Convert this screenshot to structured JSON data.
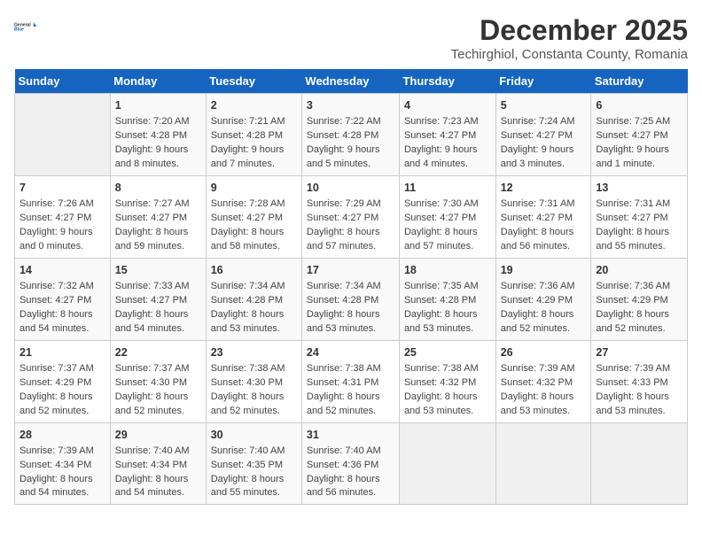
{
  "logo": {
    "general": "General",
    "blue": "Blue"
  },
  "title": "December 2025",
  "subtitle": "Techirghiol, Constanta County, Romania",
  "weekdays": [
    "Sunday",
    "Monday",
    "Tuesday",
    "Wednesday",
    "Thursday",
    "Friday",
    "Saturday"
  ],
  "weeks": [
    [
      {
        "day": "",
        "info": ""
      },
      {
        "day": "1",
        "info": "Sunrise: 7:20 AM\nSunset: 4:28 PM\nDaylight: 9 hours\nand 8 minutes."
      },
      {
        "day": "2",
        "info": "Sunrise: 7:21 AM\nSunset: 4:28 PM\nDaylight: 9 hours\nand 7 minutes."
      },
      {
        "day": "3",
        "info": "Sunrise: 7:22 AM\nSunset: 4:28 PM\nDaylight: 9 hours\nand 5 minutes."
      },
      {
        "day": "4",
        "info": "Sunrise: 7:23 AM\nSunset: 4:27 PM\nDaylight: 9 hours\nand 4 minutes."
      },
      {
        "day": "5",
        "info": "Sunrise: 7:24 AM\nSunset: 4:27 PM\nDaylight: 9 hours\nand 3 minutes."
      },
      {
        "day": "6",
        "info": "Sunrise: 7:25 AM\nSunset: 4:27 PM\nDaylight: 9 hours\nand 1 minute."
      }
    ],
    [
      {
        "day": "7",
        "info": "Sunrise: 7:26 AM\nSunset: 4:27 PM\nDaylight: 9 hours\nand 0 minutes."
      },
      {
        "day": "8",
        "info": "Sunrise: 7:27 AM\nSunset: 4:27 PM\nDaylight: 8 hours\nand 59 minutes."
      },
      {
        "day": "9",
        "info": "Sunrise: 7:28 AM\nSunset: 4:27 PM\nDaylight: 8 hours\nand 58 minutes."
      },
      {
        "day": "10",
        "info": "Sunrise: 7:29 AM\nSunset: 4:27 PM\nDaylight: 8 hours\nand 57 minutes."
      },
      {
        "day": "11",
        "info": "Sunrise: 7:30 AM\nSunset: 4:27 PM\nDaylight: 8 hours\nand 57 minutes."
      },
      {
        "day": "12",
        "info": "Sunrise: 7:31 AM\nSunset: 4:27 PM\nDaylight: 8 hours\nand 56 minutes."
      },
      {
        "day": "13",
        "info": "Sunrise: 7:31 AM\nSunset: 4:27 PM\nDaylight: 8 hours\nand 55 minutes."
      }
    ],
    [
      {
        "day": "14",
        "info": "Sunrise: 7:32 AM\nSunset: 4:27 PM\nDaylight: 8 hours\nand 54 minutes."
      },
      {
        "day": "15",
        "info": "Sunrise: 7:33 AM\nSunset: 4:27 PM\nDaylight: 8 hours\nand 54 minutes."
      },
      {
        "day": "16",
        "info": "Sunrise: 7:34 AM\nSunset: 4:28 PM\nDaylight: 8 hours\nand 53 minutes."
      },
      {
        "day": "17",
        "info": "Sunrise: 7:34 AM\nSunset: 4:28 PM\nDaylight: 8 hours\nand 53 minutes."
      },
      {
        "day": "18",
        "info": "Sunrise: 7:35 AM\nSunset: 4:28 PM\nDaylight: 8 hours\nand 53 minutes."
      },
      {
        "day": "19",
        "info": "Sunrise: 7:36 AM\nSunset: 4:29 PM\nDaylight: 8 hours\nand 52 minutes."
      },
      {
        "day": "20",
        "info": "Sunrise: 7:36 AM\nSunset: 4:29 PM\nDaylight: 8 hours\nand 52 minutes."
      }
    ],
    [
      {
        "day": "21",
        "info": "Sunrise: 7:37 AM\nSunset: 4:29 PM\nDaylight: 8 hours\nand 52 minutes."
      },
      {
        "day": "22",
        "info": "Sunrise: 7:37 AM\nSunset: 4:30 PM\nDaylight: 8 hours\nand 52 minutes."
      },
      {
        "day": "23",
        "info": "Sunrise: 7:38 AM\nSunset: 4:30 PM\nDaylight: 8 hours\nand 52 minutes."
      },
      {
        "day": "24",
        "info": "Sunrise: 7:38 AM\nSunset: 4:31 PM\nDaylight: 8 hours\nand 52 minutes."
      },
      {
        "day": "25",
        "info": "Sunrise: 7:38 AM\nSunset: 4:32 PM\nDaylight: 8 hours\nand 53 minutes."
      },
      {
        "day": "26",
        "info": "Sunrise: 7:39 AM\nSunset: 4:32 PM\nDaylight: 8 hours\nand 53 minutes."
      },
      {
        "day": "27",
        "info": "Sunrise: 7:39 AM\nSunset: 4:33 PM\nDaylight: 8 hours\nand 53 minutes."
      }
    ],
    [
      {
        "day": "28",
        "info": "Sunrise: 7:39 AM\nSunset: 4:34 PM\nDaylight: 8 hours\nand 54 minutes."
      },
      {
        "day": "29",
        "info": "Sunrise: 7:40 AM\nSunset: 4:34 PM\nDaylight: 8 hours\nand 54 minutes."
      },
      {
        "day": "30",
        "info": "Sunrise: 7:40 AM\nSunset: 4:35 PM\nDaylight: 8 hours\nand 55 minutes."
      },
      {
        "day": "31",
        "info": "Sunrise: 7:40 AM\nSunset: 4:36 PM\nDaylight: 8 hours\nand 56 minutes."
      },
      {
        "day": "",
        "info": ""
      },
      {
        "day": "",
        "info": ""
      },
      {
        "day": "",
        "info": ""
      }
    ]
  ]
}
